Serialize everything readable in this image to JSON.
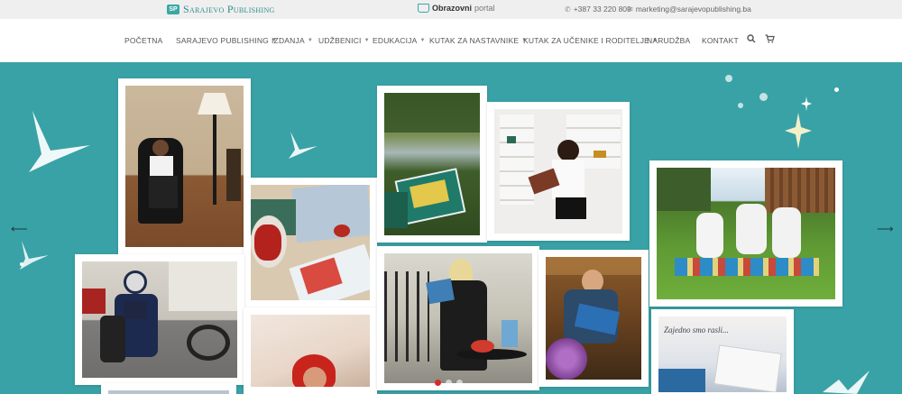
{
  "topbar": {
    "logo_text": "Sarajevo Publishing",
    "logo_mark": "SP",
    "portal_a": "Obrazovni",
    "portal_b": "portal",
    "phone": "+387 33 220 809",
    "email": "marketing@sarajevopublishing.ba"
  },
  "nav": {
    "items": [
      {
        "label": "POČETNA",
        "has_dropdown": false
      },
      {
        "label": "SARAJEVO PUBLISHING",
        "has_dropdown": true
      },
      {
        "label": "IZDANJA",
        "has_dropdown": true
      },
      {
        "label": "UDŽBENICI",
        "has_dropdown": true
      },
      {
        "label": "EDUKACIJA",
        "has_dropdown": true
      },
      {
        "label": "KUTAK ZA NASTAVNIKE",
        "has_dropdown": true
      },
      {
        "label": "KUTAK ZA UČENIKE I RODITELJE",
        "has_dropdown": true
      },
      {
        "label": "NARUDŽBA",
        "has_dropdown": false
      },
      {
        "label": "KONTAKT",
        "has_dropdown": false
      }
    ],
    "icons": [
      "search-icon",
      "cart-icon"
    ]
  },
  "hero": {
    "background": "#39a2a6",
    "caption": "Zajedno smo rasli...",
    "slides": 3,
    "active_slide": 1
  }
}
